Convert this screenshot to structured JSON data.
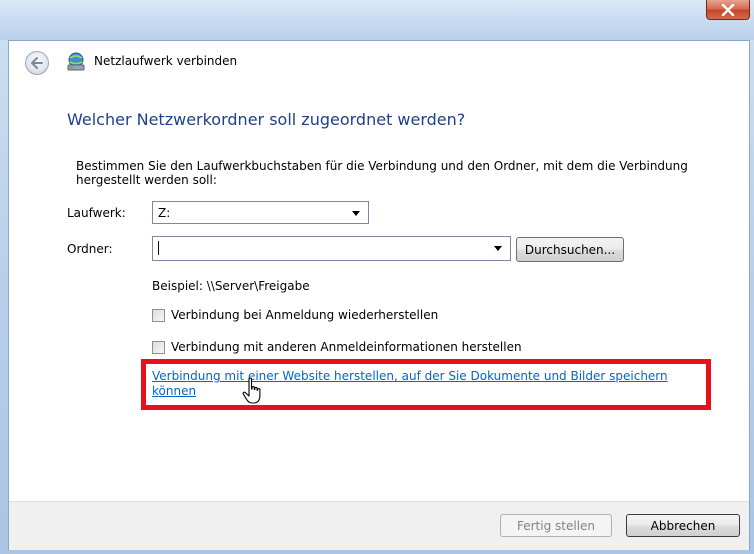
{
  "window": {
    "title": "Netzlaufwerk verbinden",
    "close_label": "close"
  },
  "heading": "Welcher Netzwerkordner soll zugeordnet werden?",
  "description": "Bestimmen Sie den Laufwerkbuchstaben für die Verbindung und den Ordner, mit dem die Verbindung hergestellt werden soll:",
  "drive": {
    "label": "Laufwerk:",
    "value": "Z:"
  },
  "folder": {
    "label": "Ordner:",
    "value": "",
    "browse_label": "Durchsuchen..."
  },
  "example": "Beispiel: \\\\Server\\Freigabe",
  "options": {
    "reconnect_label": "Verbindung bei Anmeldung wiederherstellen",
    "reconnect_checked": false,
    "other_credentials_label": "Verbindung mit anderen Anmeldeinformationen herstellen",
    "other_credentials_checked": false
  },
  "website_link": "Verbindung mit einer Website herstellen, auf der Sie Dokumente und Bilder speichern können",
  "footer": {
    "finish_label": "Fertig stellen",
    "cancel_label": "Abbrechen"
  },
  "colors": {
    "heading": "#1e3f8c",
    "link": "#0066cc",
    "highlight": "#e8101a"
  },
  "icons": {
    "back": "back-arrow-icon",
    "network": "network-drive-icon",
    "cursor": "hand-pointer-icon"
  }
}
